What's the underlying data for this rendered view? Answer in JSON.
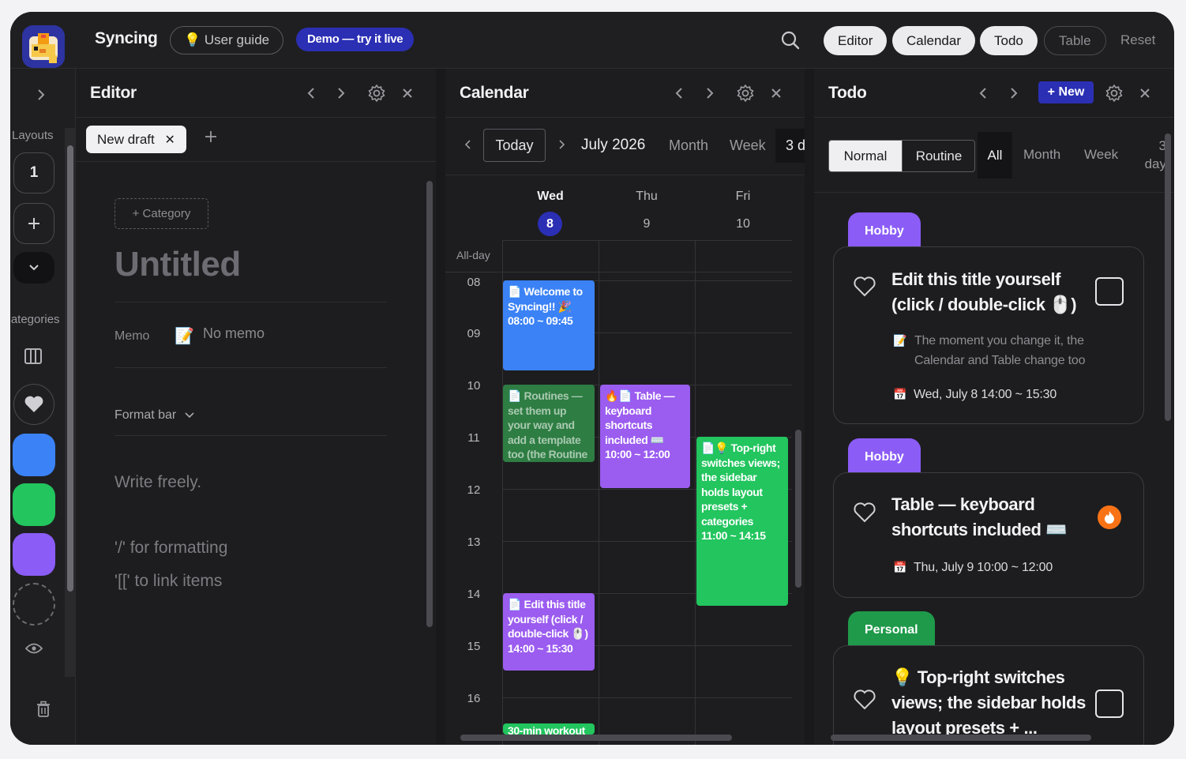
{
  "app": {
    "title": "Syncing",
    "user_guide_label": "User guide",
    "demo_label": "Demo — try it live",
    "views": [
      "Editor",
      "Calendar",
      "Todo",
      "Table"
    ],
    "active_views": [
      "Editor",
      "Calendar",
      "Todo"
    ],
    "reset_label": "Reset"
  },
  "sidebar": {
    "layouts_label": "Layouts",
    "layout_preset": "1",
    "categories_label": "Categories",
    "category_colors": [
      "#3b82f6",
      "#22c55e",
      "#8b5cf6"
    ]
  },
  "editor": {
    "title": "Editor",
    "tab_label": "New draft",
    "category_button": "+ Category",
    "untitled": "Untitled",
    "memo_label": "Memo",
    "memo_value": "No memo",
    "format_bar_label": "Format bar",
    "placeholder": "Write freely.",
    "hint_formatting": "'/' for formatting",
    "hint_link": "'[[' to link items"
  },
  "calendar": {
    "title": "Calendar",
    "today_label": "Today",
    "month_label": "July 2026",
    "view_month": "Month",
    "view_week": "Week",
    "view_3d": "3 d",
    "days": [
      {
        "name": "Wed",
        "num": "8",
        "today": true
      },
      {
        "name": "Thu",
        "num": "9",
        "today": false
      },
      {
        "name": "Fri",
        "num": "10",
        "today": false
      }
    ],
    "allday_label": "All-day",
    "hours": [
      "08",
      "09",
      "10",
      "11",
      "12",
      "13",
      "14",
      "15",
      "16"
    ],
    "events": [
      {
        "text": "📄 Welcome to Syncing!! 🎉",
        "time": "08:00 ~ 09:45",
        "day": 0,
        "color": "#3b82f6"
      },
      {
        "text": "📄 Routines — set them up your way and add a template too (the Routine",
        "time": "",
        "day": 0,
        "color": "#2e7d43"
      },
      {
        "text": "🔥📄 Table — keyboard shortcuts included ⌨️",
        "time": "10:00 ~ 12:00",
        "day": 1,
        "color": "#9b5cf0"
      },
      {
        "text": "📄💡 Top-right switches views; the sidebar holds layout presets + categories",
        "time": "11:00 ~ 14:15",
        "day": 2,
        "color": "#22c55e"
      },
      {
        "text": "📄 Edit this title yourself (click / double-click 🖱️)",
        "time": "14:00 ~ 15:30",
        "day": 0,
        "color": "#9b5cf0"
      },
      {
        "text": "30-min workout",
        "time": "",
        "day": 0,
        "color": "#22c55e"
      }
    ]
  },
  "todo": {
    "title": "Todo",
    "new_label": "+ New",
    "mode_normal": "Normal",
    "mode_routine": "Routine",
    "filter_all": "All",
    "filter_month": "Month",
    "filter_week": "Week",
    "filter_3day_line1": "3",
    "filter_3day_line2": "day",
    "items": [
      {
        "category": "Hobby",
        "category_color": "#8b5cf6",
        "title_line1": "Edit this title yourself",
        "title_line2": "(click / double-click 🖱️)",
        "memo_line1": "The moment you change it, the",
        "memo_line2": "Calendar and Table change too",
        "date": "Wed, July 8 14:00 ~ 15:30"
      },
      {
        "category": "Hobby",
        "category_color": "#8b5cf6",
        "title_line1": "Table — keyboard",
        "title_line2": "shortcuts included ⌨️",
        "date": "Thu, July 9 10:00 ~ 12:00"
      },
      {
        "category": "Personal",
        "category_color": "#1f9a4a",
        "title_line1": "💡 Top-right switches",
        "title_line2": "views; the sidebar holds",
        "title_line3": "layout presets + ..."
      }
    ]
  }
}
